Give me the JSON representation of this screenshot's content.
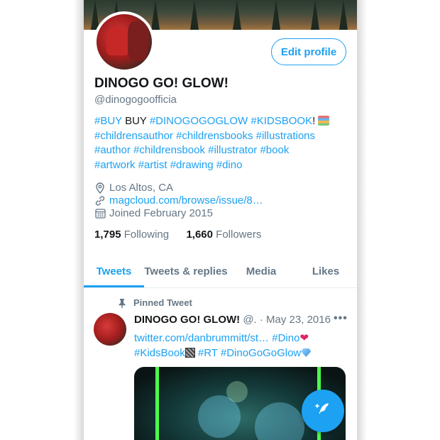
{
  "profile": {
    "edit_label": "Edit profile",
    "name": "DINOGO GO! GLOW!",
    "handle": "@dinogogoofficia",
    "bio": {
      "line1_tag1": "#BUY",
      "line1_text": " BUY ",
      "line1_tag2": "#DINOGOGOGLOW",
      "line1_tag3": "#KIDSBOOK",
      "line1_suffix": "!",
      "line2": "#childrensauthor #childrensbooks #illustrations",
      "line3": "#author #childrensbook #illustrator #book",
      "line4": "#artwork #artist #drawing #dino"
    },
    "location": "Los Altos, CA",
    "website": "magcloud.com/browse/issue/8…",
    "joined": "Joined February 2015",
    "following_count": "1,795",
    "following_label": "Following",
    "followers_count": "1,660",
    "followers_label": "Followers"
  },
  "tabs": [
    {
      "label": "Tweets",
      "active": true
    },
    {
      "label": "Tweets & replies",
      "active": false
    },
    {
      "label": "Media",
      "active": false
    },
    {
      "label": "Likes",
      "active": false
    }
  ],
  "pinned_tweet": {
    "pinned_label": "Pinned Tweet",
    "author": "DINOGO GO! GLOW!",
    "meta": "@. · May 23, 2016",
    "more": "•••",
    "text_line1_link": "twitter.com/danbrummitt/st…",
    "text_line1_tag": "#Dino",
    "text_line2_tag1": "#KidsBook",
    "text_line2_tag2": "#RT",
    "text_line2_tag3": "#DinoGoGoGlow"
  },
  "icons": {
    "location": "location-pin-icon",
    "link": "link-icon",
    "calendar": "calendar-icon",
    "pin": "pin-icon",
    "compose": "compose-tweet-icon"
  },
  "colors": {
    "accent": "#1da1f2",
    "text": "#14171a",
    "secondary": "#657786"
  }
}
